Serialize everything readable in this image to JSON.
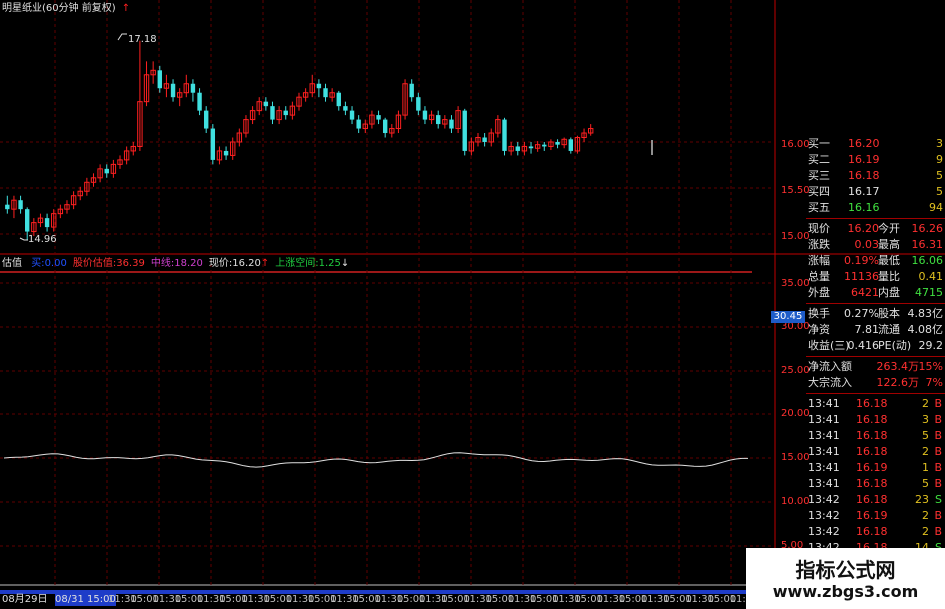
{
  "title": "明星纸业(60分钟 前复权)",
  "title_arrow": "↑",
  "price_high_label": "17.18",
  "price_low_label": "14.96",
  "price_axis": [
    "16.00",
    "15.50",
    "15.00"
  ],
  "indicator_bar": {
    "name": "估值",
    "items": [
      {
        "label": "买:",
        "value": "0.00",
        "color": "#2050ff"
      },
      {
        "label": "股价估值:",
        "value": "36.39",
        "color": "#ff3030"
      },
      {
        "label": "中线:",
        "value": "18.20",
        "color": "#d040d0"
      },
      {
        "label": "现价:",
        "value": "16.20",
        "color": "#e0e0e0",
        "arrow": "↑"
      },
      {
        "label": "上涨空间:",
        "value": "1.25",
        "color": "#20d040",
        "arrow": "↓"
      }
    ]
  },
  "indicator_axis": [
    "35.00",
    "30.00",
    "25.00",
    "20.00",
    "15.00",
    "10.00",
    "5.00"
  ],
  "indicator_current": "30.45",
  "time_axis": {
    "dates": [
      "08月29日",
      "08/31 15:00"
    ],
    "ticks": [
      "11:30",
      "15:00",
      "11:30",
      "15:00",
      "11:30",
      "15:00",
      "11:30",
      "15:00",
      "11:30",
      "15:00",
      "11:30",
      "15:00",
      "11:30",
      "15:00",
      "11:30",
      "15:00",
      "11:30",
      "15:00",
      "11:30",
      "15:00",
      "11:30",
      "15:00",
      "11:30",
      "15:00",
      "11:30",
      "15:00",
      "11:30",
      "15:00",
      "11:30",
      "15:00",
      "11:3"
    ]
  },
  "bids": [
    {
      "label": "买一",
      "price": "16.20",
      "vol": "3"
    },
    {
      "label": "买二",
      "price": "16.19",
      "vol": "9"
    },
    {
      "label": "买三",
      "price": "16.18",
      "vol": "5"
    },
    {
      "label": "买四",
      "price": "16.17",
      "vol": "5"
    },
    {
      "label": "买五",
      "price": "16.16",
      "vol": "94"
    }
  ],
  "quote": [
    {
      "l1": "现价",
      "v1": "16.20",
      "l2": "今开",
      "v2": "16.26"
    },
    {
      "l1": "涨跌",
      "v1": "0.03",
      "l2": "最高",
      "v2": "16.31"
    },
    {
      "l1": "涨幅",
      "v1": "0.19%",
      "l2": "最低",
      "v2": "16.06"
    },
    {
      "l1": "总量",
      "v1": "11136",
      "l2": "量比",
      "v2": "0.41"
    },
    {
      "l1": "外盘",
      "v1": "6421",
      "l2": "内盘",
      "v2": "4715"
    }
  ],
  "fundamentals": [
    {
      "l1": "换手",
      "v1": "0.27%",
      "l2": "股本",
      "v2": "4.83亿"
    },
    {
      "l1": "净资",
      "v1": "7.81",
      "l2": "流通",
      "v2": "4.08亿"
    },
    {
      "l1": "收益(三)",
      "v1": "0.416",
      "l2": "PE(动)",
      "v2": "29.2"
    }
  ],
  "flows": [
    {
      "label": "净流入额",
      "value": "263.4万",
      "pct": "15%"
    },
    {
      "label": "大宗流入",
      "value": "122.6万",
      "pct": "7%"
    }
  ],
  "ticks": [
    {
      "time": "13:41",
      "price": "16.18",
      "vol": "2",
      "side": "B"
    },
    {
      "time": "13:41",
      "price": "16.18",
      "vol": "3",
      "side": "B"
    },
    {
      "time": "13:41",
      "price": "16.18",
      "vol": "5",
      "side": "B"
    },
    {
      "time": "13:41",
      "price": "16.18",
      "vol": "2",
      "side": "B"
    },
    {
      "time": "13:41",
      "price": "16.19",
      "vol": "1",
      "side": "B"
    },
    {
      "time": "13:41",
      "price": "16.18",
      "vol": "5",
      "side": "B"
    },
    {
      "time": "13:42",
      "price": "16.18",
      "vol": "23",
      "side": "S"
    },
    {
      "time": "13:42",
      "price": "16.19",
      "vol": "2",
      "side": "B"
    },
    {
      "time": "13:42",
      "price": "16.18",
      "vol": "2",
      "side": "B"
    },
    {
      "time": "13:42",
      "price": "16.18",
      "vol": "14",
      "side": "S"
    }
  ],
  "watermark": {
    "title": "指标公式网",
    "url": "www.zbgs3.com"
  },
  "colors": {
    "up": "#ff2020",
    "down": "#40e0e0",
    "grid": "#600000",
    "axis": "#c00000",
    "line": "#e0e0e0"
  },
  "chart_data": {
    "type": "candlestick",
    "y_range": [
      14.9,
      17.3
    ],
    "candles": [
      [
        15.35,
        15.3,
        15.45,
        15.25
      ],
      [
        15.3,
        15.4,
        15.45,
        15.2
      ],
      [
        15.4,
        15.3,
        15.45,
        15.25
      ],
      [
        15.3,
        15.05,
        15.32,
        14.96
      ],
      [
        15.05,
        15.15,
        15.2,
        15.0
      ],
      [
        15.15,
        15.2,
        15.25,
        15.1
      ],
      [
        15.2,
        15.1,
        15.25,
        15.05
      ],
      [
        15.1,
        15.25,
        15.3,
        15.05
      ],
      [
        15.25,
        15.3,
        15.35,
        15.2
      ],
      [
        15.3,
        15.35,
        15.4,
        15.25
      ],
      [
        15.35,
        15.45,
        15.5,
        15.3
      ],
      [
        15.45,
        15.5,
        15.55,
        15.4
      ],
      [
        15.5,
        15.6,
        15.65,
        15.45
      ],
      [
        15.6,
        15.65,
        15.7,
        15.55
      ],
      [
        15.65,
        15.75,
        15.8,
        15.6
      ],
      [
        15.75,
        15.7,
        15.8,
        15.65
      ],
      [
        15.7,
        15.8,
        15.85,
        15.65
      ],
      [
        15.8,
        15.85,
        15.9,
        15.75
      ],
      [
        15.85,
        15.95,
        16.0,
        15.8
      ],
      [
        15.95,
        16.0,
        16.05,
        15.9
      ],
      [
        16.0,
        16.5,
        17.18,
        15.95
      ],
      [
        16.5,
        16.8,
        16.95,
        16.45
      ],
      [
        16.8,
        16.85,
        16.95,
        16.7
      ],
      [
        16.85,
        16.65,
        16.9,
        16.6
      ],
      [
        16.65,
        16.7,
        16.8,
        16.55
      ],
      [
        16.7,
        16.55,
        16.75,
        16.5
      ],
      [
        16.55,
        16.6,
        16.65,
        16.45
      ],
      [
        16.6,
        16.7,
        16.8,
        16.55
      ],
      [
        16.7,
        16.6,
        16.75,
        16.5
      ],
      [
        16.6,
        16.4,
        16.65,
        16.35
      ],
      [
        16.4,
        16.2,
        16.45,
        16.15
      ],
      [
        16.2,
        15.85,
        16.25,
        15.8
      ],
      [
        15.85,
        15.95,
        16.0,
        15.8
      ],
      [
        15.95,
        15.9,
        16.0,
        15.85
      ],
      [
        15.9,
        16.05,
        16.1,
        15.85
      ],
      [
        16.05,
        16.15,
        16.2,
        16.0
      ],
      [
        16.15,
        16.3,
        16.35,
        16.1
      ],
      [
        16.3,
        16.4,
        16.45,
        16.25
      ],
      [
        16.4,
        16.5,
        16.55,
        16.35
      ],
      [
        16.5,
        16.45,
        16.55,
        16.4
      ],
      [
        16.45,
        16.3,
        16.5,
        16.25
      ],
      [
        16.3,
        16.4,
        16.45,
        16.25
      ],
      [
        16.4,
        16.35,
        16.45,
        16.3
      ],
      [
        16.35,
        16.45,
        16.5,
        16.3
      ],
      [
        16.45,
        16.55,
        16.6,
        16.4
      ],
      [
        16.55,
        16.6,
        16.65,
        16.5
      ],
      [
        16.6,
        16.7,
        16.8,
        16.55
      ],
      [
        16.7,
        16.65,
        16.75,
        16.55
      ],
      [
        16.65,
        16.55,
        16.7,
        16.5
      ],
      [
        16.55,
        16.6,
        16.65,
        16.5
      ],
      [
        16.6,
        16.45,
        16.62,
        16.4
      ],
      [
        16.45,
        16.4,
        16.5,
        16.35
      ],
      [
        16.4,
        16.3,
        16.45,
        16.25
      ],
      [
        16.3,
        16.2,
        16.35,
        16.15
      ],
      [
        16.2,
        16.25,
        16.3,
        16.15
      ],
      [
        16.25,
        16.35,
        16.4,
        16.2
      ],
      [
        16.35,
        16.3,
        16.4,
        16.25
      ],
      [
        16.3,
        16.15,
        16.32,
        16.1
      ],
      [
        16.15,
        16.2,
        16.25,
        16.1
      ],
      [
        16.2,
        16.35,
        16.4,
        16.15
      ],
      [
        16.35,
        16.7,
        16.75,
        16.3
      ],
      [
        16.7,
        16.55,
        16.75,
        16.5
      ],
      [
        16.55,
        16.4,
        16.6,
        16.35
      ],
      [
        16.4,
        16.3,
        16.45,
        16.25
      ],
      [
        16.3,
        16.35,
        16.4,
        16.25
      ],
      [
        16.35,
        16.25,
        16.4,
        16.2
      ],
      [
        16.25,
        16.3,
        16.35,
        16.2
      ],
      [
        16.3,
        16.2,
        16.35,
        16.15
      ],
      [
        16.2,
        16.4,
        16.45,
        16.15
      ],
      [
        16.4,
        15.95,
        16.42,
        15.9
      ],
      [
        15.95,
        16.05,
        16.1,
        15.9
      ],
      [
        16.05,
        16.1,
        16.15,
        16.0
      ],
      [
        16.1,
        16.05,
        16.15,
        16.0
      ],
      [
        16.05,
        16.15,
        16.2,
        16.0
      ],
      [
        16.15,
        16.3,
        16.35,
        16.1
      ],
      [
        16.3,
        15.95,
        16.32,
        15.9
      ],
      [
        15.95,
        16.0,
        16.05,
        15.9
      ],
      [
        16.0,
        15.95,
        16.05,
        15.9
      ],
      [
        15.95,
        16.0,
        16.05,
        15.9
      ],
      [
        16.0,
        15.98,
        16.05,
        15.92
      ],
      [
        15.98,
        16.02,
        16.06,
        15.94
      ],
      [
        16.02,
        16.0,
        16.05,
        15.95
      ],
      [
        16.0,
        16.05,
        16.08,
        15.96
      ],
      [
        16.05,
        16.02,
        16.08,
        15.98
      ],
      [
        16.02,
        16.08,
        16.1,
        15.98
      ],
      [
        16.08,
        15.95,
        16.1,
        15.92
      ],
      [
        15.95,
        16.1,
        16.12,
        15.92
      ],
      [
        16.1,
        16.15,
        16.2,
        16.05
      ],
      [
        16.15,
        16.2,
        16.25,
        16.12
      ]
    ],
    "indicator_line_level": 16.0,
    "indicator_line_range": [
      0,
      40
    ]
  }
}
